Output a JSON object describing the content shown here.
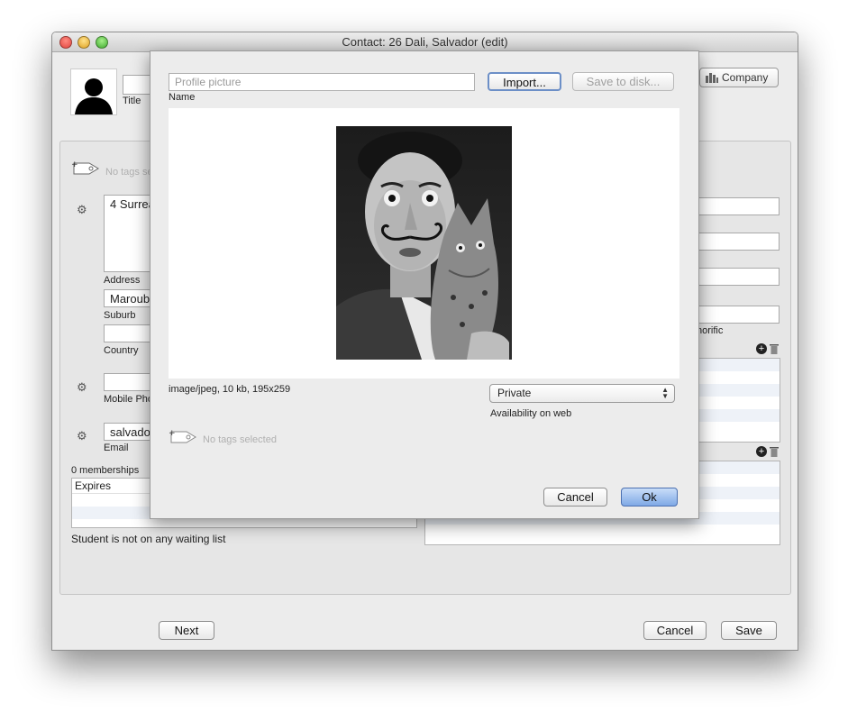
{
  "window": {
    "title": "Contact: 26 Dali, Salvador (edit)"
  },
  "header": {
    "title_label": "Title",
    "company_label": "Company"
  },
  "left": {
    "tags_placeholder": "No tags sel",
    "address_value": "4 Surrea",
    "address_label": "Address",
    "suburb_value": "Maroubı",
    "suburb_label": "Suburb",
    "country_value": "",
    "country_label": "Country",
    "mobile_value": "",
    "mobile_label": "Mobile Pho",
    "email_value": "salvador",
    "email_label": "Email",
    "memberships_label": "0 memberships",
    "expires_header": "Expires",
    "waiting_list_text": "Student is not on any waiting list"
  },
  "right": {
    "honorific_label": "norific"
  },
  "footer": {
    "next_label": "Next",
    "cancel_label": "Cancel",
    "save_label": "Save"
  },
  "dialog": {
    "name_placeholder": "Profile picture",
    "name_label": "Name",
    "import_label": "Import...",
    "save_disk_label": "Save to disk...",
    "image_meta": "image/jpeg, 10 kb, 195x259",
    "availability_value": "Private",
    "availability_label": "Availability on web",
    "tags_placeholder": "No tags selected",
    "cancel_label": "Cancel",
    "ok_label": "Ok"
  }
}
